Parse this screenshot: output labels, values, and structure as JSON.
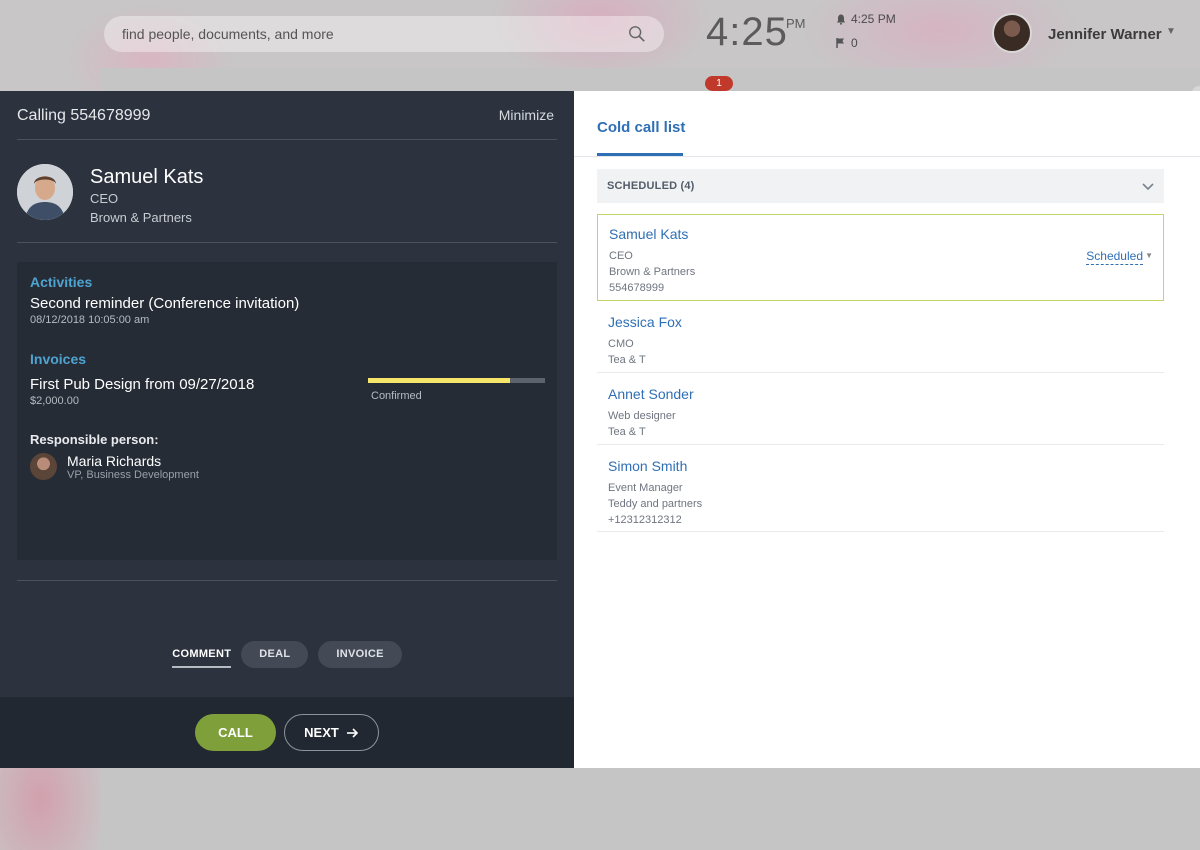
{
  "header": {
    "search_placeholder": "find people, documents, and more",
    "time": "4:25",
    "time_suffix": "PM",
    "alarm_time": "4:25 PM",
    "flag_count": "0",
    "user_name": "Jennifer Warner",
    "notification_count": "1"
  },
  "call_panel": {
    "title": "Calling 554678999",
    "minimize_label": "Minimize",
    "contact": {
      "name": "Samuel Kats",
      "role": "CEO",
      "company": "Brown & Partners"
    },
    "activities": {
      "label": "Activities",
      "title": "Second reminder (Conference invitation)",
      "date": "08/12/2018 10:05:00 am"
    },
    "invoices": {
      "label": "Invoices",
      "title": "First Pub Design from 09/27/2018",
      "amount": "$2,000.00",
      "status": "Confirmed",
      "progress": 0.8
    },
    "responsible": {
      "label": "Responsible person:",
      "name": "Maria Richards",
      "title": "VP, Business Development"
    },
    "tabs": [
      "COMMENT",
      "DEAL",
      "INVOICE"
    ],
    "call_label": "CALL",
    "next_label": "NEXT"
  },
  "list_panel": {
    "tab_label": "Cold call list",
    "group_title": "SCHEDULED (4)",
    "contacts": [
      {
        "name": "Samuel Kats",
        "line1": "CEO",
        "line2": "Brown & Partners",
        "line3": "554678999",
        "status": "Scheduled"
      },
      {
        "name": "Jessica Fox",
        "line1": "CMO",
        "line2": "Tea & T"
      },
      {
        "name": "Annet Sonder",
        "line1": "Web designer",
        "line2": "Tea & T"
      },
      {
        "name": "Simon Smith",
        "line1": "Event Manager",
        "line2": "Teddy and partners",
        "line3": "+12312312312"
      }
    ]
  },
  "colors": {
    "accent_blue": "#2f6fb6",
    "call_green": "#7e9f3a",
    "progress_yellow": "#f5e66a",
    "panel_dark": "#2c333e"
  }
}
